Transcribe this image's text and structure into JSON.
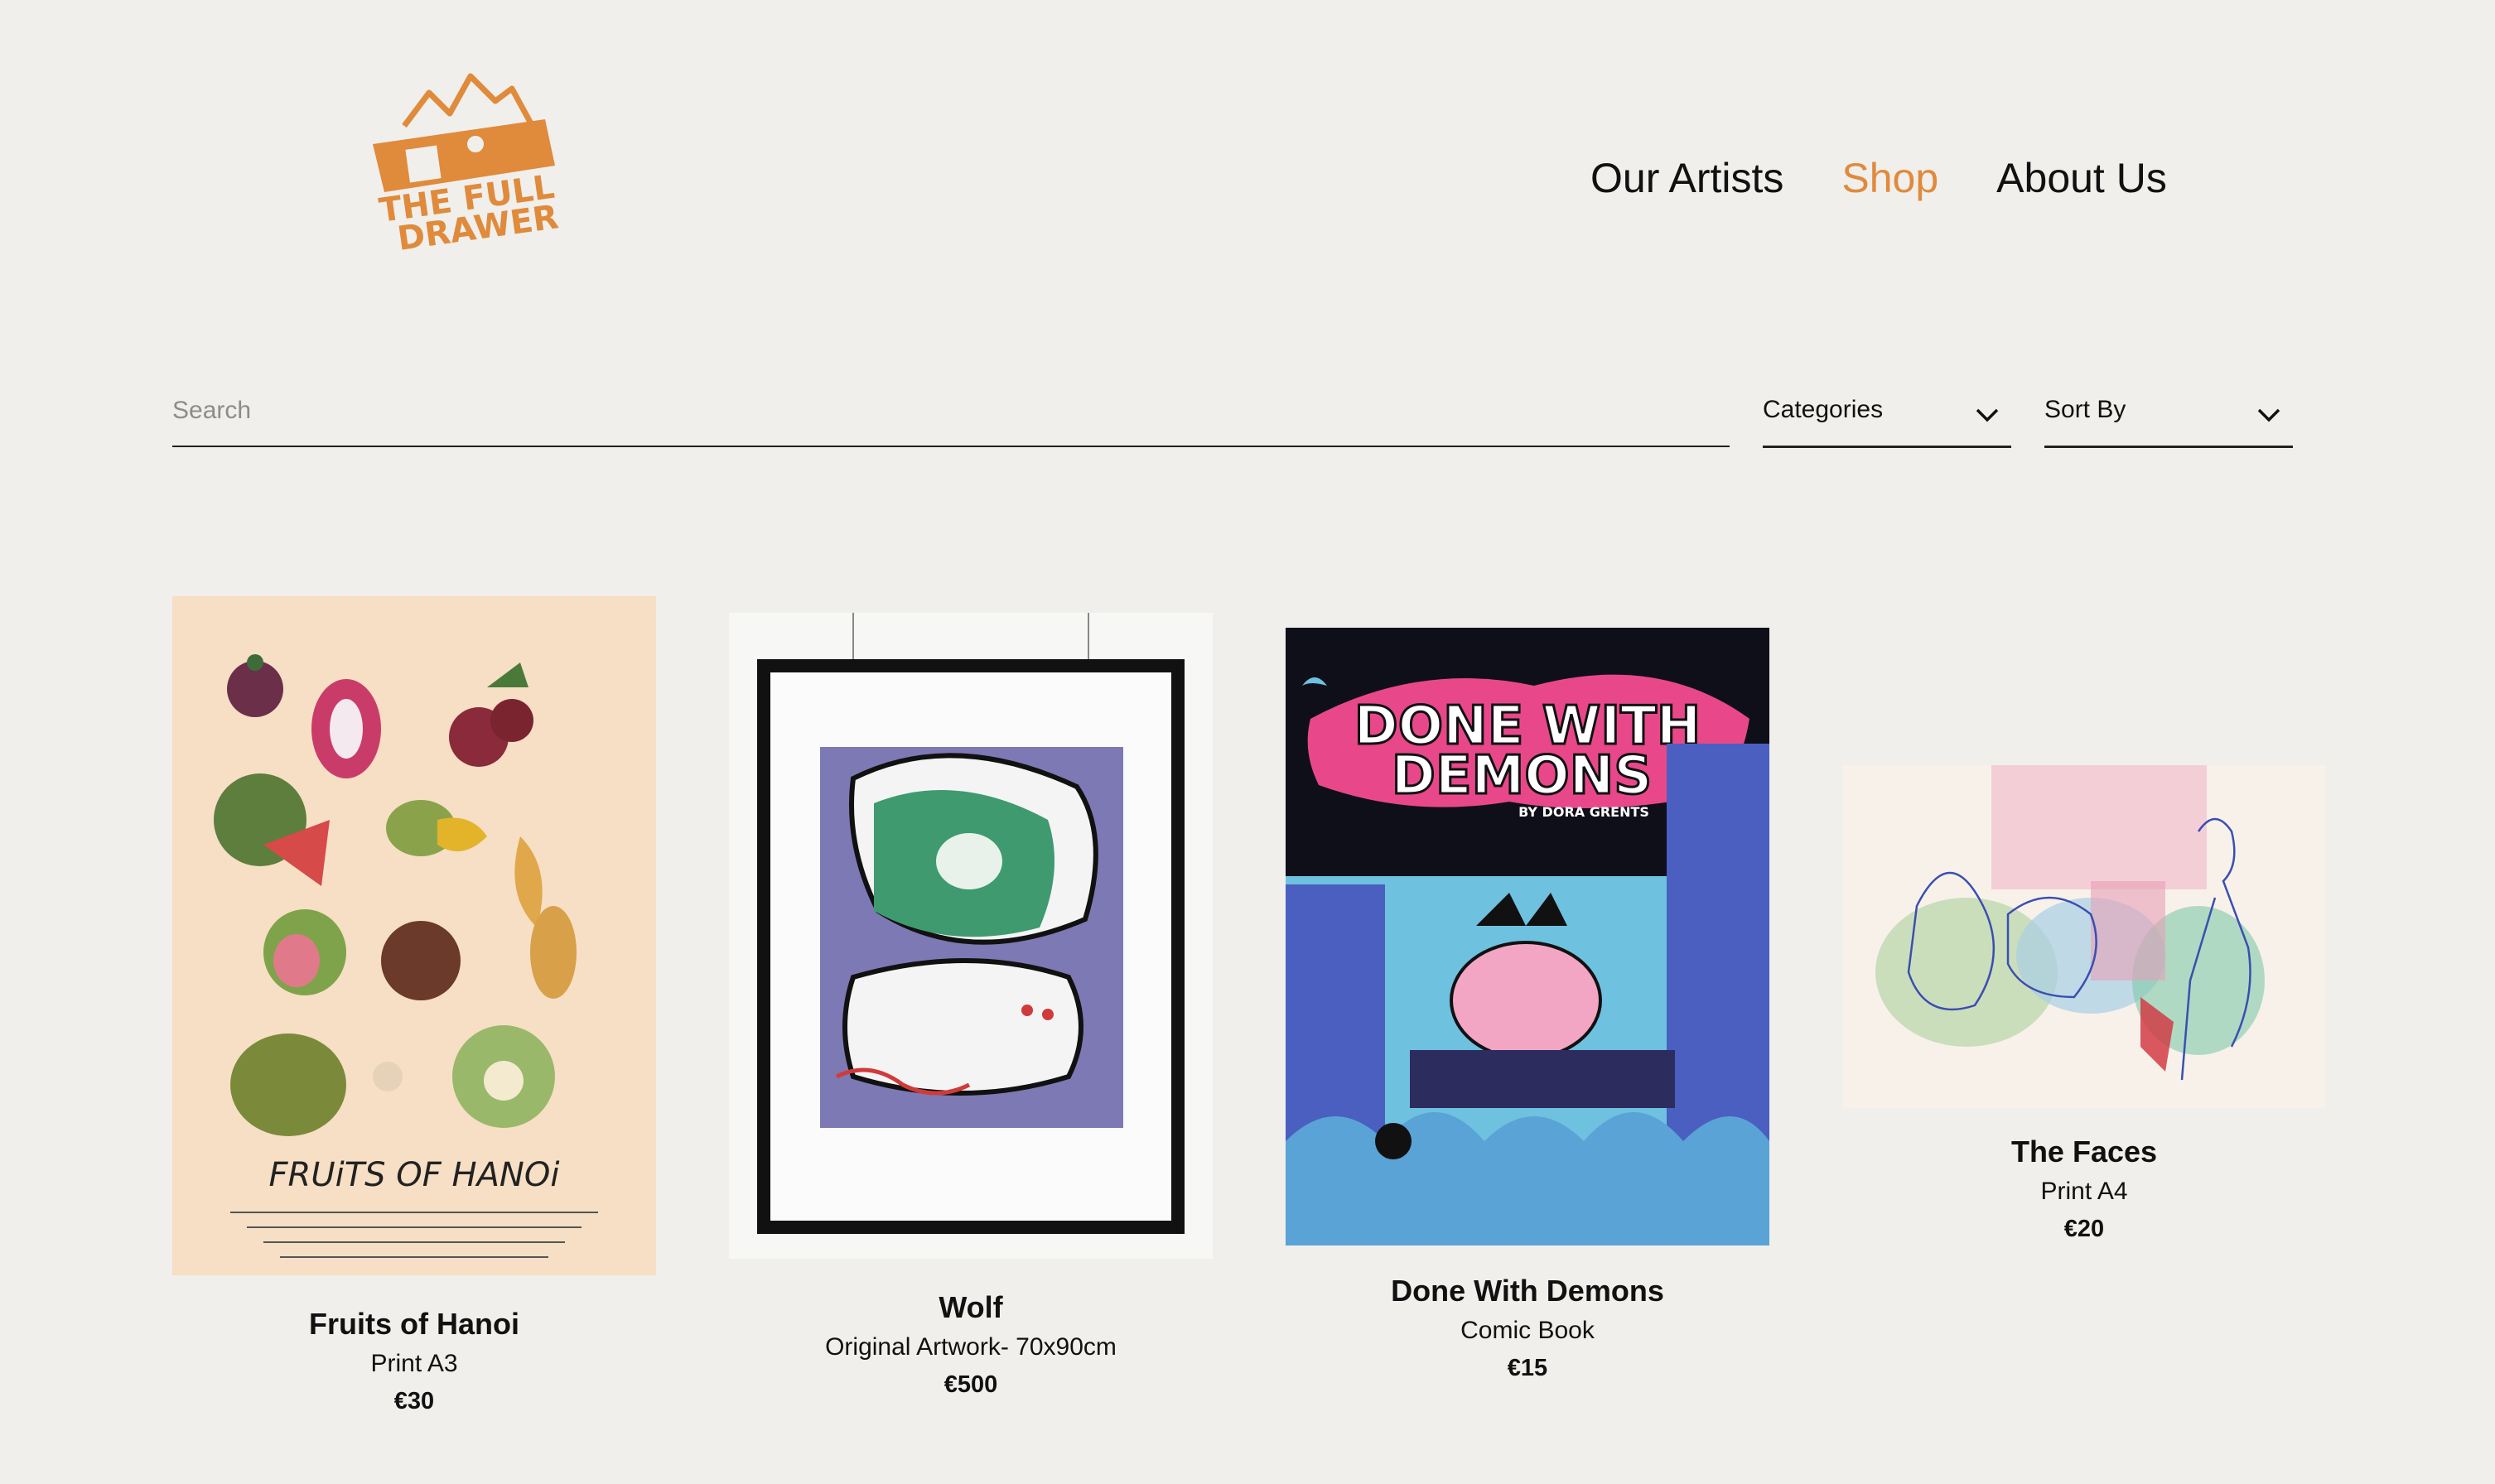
{
  "brand": {
    "logo_text_line1": "THE FULL",
    "logo_text_line2": "DRAWER",
    "accent": "#e08a3c"
  },
  "nav": {
    "items": [
      {
        "label": "Our Artists",
        "active": false
      },
      {
        "label": "Shop",
        "active": true
      },
      {
        "label": "About Us",
        "active": false
      }
    ]
  },
  "filters": {
    "search_placeholder": "Search",
    "search_value": "",
    "categories_label": "Categories",
    "sort_label": "Sort By"
  },
  "products": [
    {
      "title": "Fruits of Hanoi",
      "subtitle": "Print A3",
      "price": "€30",
      "art_heading": "FRUiTS OF HANOi"
    },
    {
      "title": "Wolf",
      "subtitle": "Original Artwork- 70x90cm",
      "price": "€500"
    },
    {
      "title": "Done With Demons",
      "subtitle": "Comic Book",
      "price": "€15",
      "art_heading_1": "DONE WITH",
      "art_heading_2": "DEMONS",
      "art_byline": "BY DORA GRENTS"
    },
    {
      "title": "The Faces",
      "subtitle": "Print A4",
      "price": "€20"
    }
  ]
}
